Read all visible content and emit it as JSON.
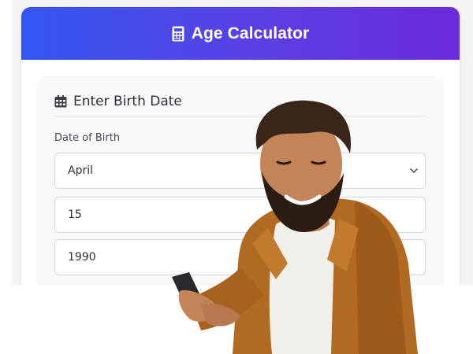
{
  "header": {
    "title": "Age Calculator",
    "icon": "calculator-icon"
  },
  "birth_section": {
    "title": "Enter Birth Date",
    "icon": "calendar-icon",
    "label": "Date of Birth",
    "month": "April",
    "day": "15",
    "year": "1990"
  },
  "colors": {
    "header_gradient_start": "#3457f2",
    "header_gradient_end": "#6b2bdb"
  }
}
